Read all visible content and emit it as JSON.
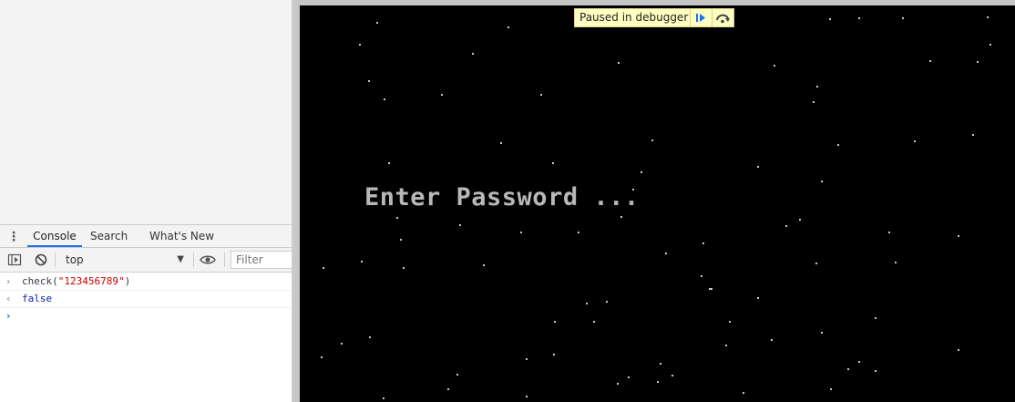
{
  "drawer": {
    "tabs": [
      {
        "label": "Console",
        "active": true
      },
      {
        "label": "Search",
        "active": false
      },
      {
        "label": "What's New",
        "active": false
      }
    ]
  },
  "toolbar": {
    "context": "top",
    "filter_placeholder": "Filter"
  },
  "console": {
    "input": {
      "fn": "check(",
      "arg": "\"123456789\"",
      "close": ")"
    },
    "result": "false"
  },
  "game": {
    "prompt_text": "Enter Password ..."
  },
  "debugger": {
    "label": "Paused in debugger",
    "resume_icon": "resume-icon",
    "step_over_icon": "step-over-icon"
  },
  "colors": {
    "accent": "#1a73e8",
    "string": "#c80000",
    "boolean": "#0d22aa",
    "banner_bg": "#ffffc2"
  }
}
